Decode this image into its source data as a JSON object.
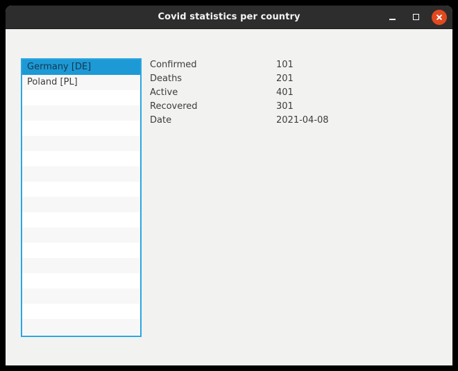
{
  "window": {
    "title": "Covid statistics per country",
    "controls": {
      "minimize": "minimize",
      "maximize": "maximize",
      "close": "close"
    }
  },
  "country_list": {
    "items": [
      {
        "label": "Germany [DE]",
        "selected": true
      },
      {
        "label": "Poland [PL]",
        "selected": false
      }
    ],
    "empty_row_count": 16
  },
  "stats": {
    "rows": [
      {
        "label": "Confirmed",
        "value": "101"
      },
      {
        "label": "Deaths",
        "value": "201"
      },
      {
        "label": "Active",
        "value": "401"
      },
      {
        "label": "Recovered",
        "value": "301"
      },
      {
        "label": "Date",
        "value": "2021-04-08"
      }
    ]
  },
  "colors": {
    "titlebar_bg": "#2d2d2d",
    "titlebar_text": "#f4f4f4",
    "close_button": "#e1491f",
    "content_bg": "#f2f2f1",
    "list_border": "#2aa6e0",
    "list_bg": "#ffffff",
    "alt_row": "#f7f7f7",
    "selection_bg": "#1d99d5",
    "selection_text": "#14384d",
    "text": "#3c3c3c"
  }
}
